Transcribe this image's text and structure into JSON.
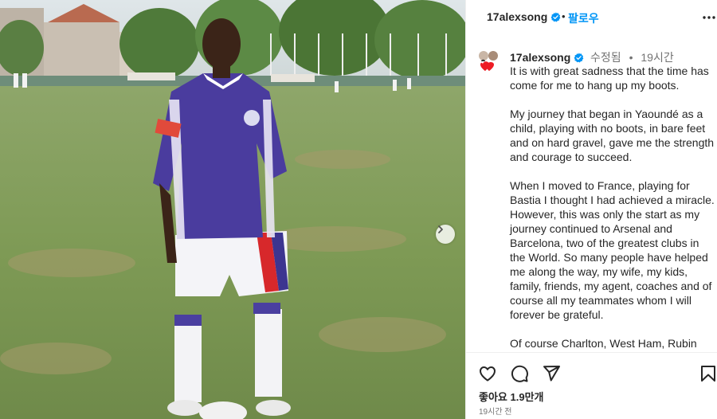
{
  "post": {
    "username": "17alexsong",
    "follow_label": "팔로우",
    "separator": "•",
    "photo_alt": "Young footballer in purple kit standing on a grass pitch"
  },
  "caption": {
    "username": "17alexsong",
    "edited_label": "수정됨",
    "separator": "•",
    "time": "19시간",
    "paragraphs": [
      "It is with great sadness that the time has come for me to hang up my boots.",
      "My journey that began in Yaoundé as a child, playing with no boots, in bare feet and on hard gravel, gave me the strength and courage to succeed.",
      "When I moved to France, playing for Bastia I thought I had achieved a miracle. However, this was only the start as my journey continued to Arsenal and Barcelona, two of the greatest clubs in the World. So many people have helped me along the way, my wife, my kids, family, friends, my agent, coaches and of course all my teammates whom I will forever be grateful.",
      "Of course Charlton, West Ham, Rubin"
    ]
  },
  "footer": {
    "likes": "좋아요 1.9만개",
    "time_ago": "19시간 전"
  },
  "colors": {
    "accent": "#0095f6",
    "verified": "#0095f6",
    "text": "#262626",
    "muted": "#737373",
    "heart": "#ed1c24"
  }
}
